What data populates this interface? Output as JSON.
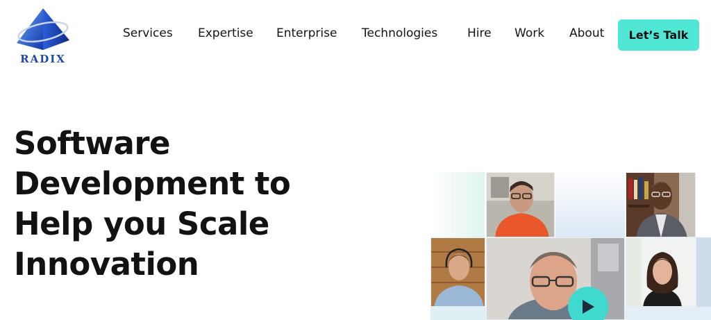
{
  "brand": {
    "name": "RADIX",
    "color": "#1f46b0"
  },
  "nav": {
    "items": [
      "Services",
      "Expertise",
      "Enterprise",
      "Technologies",
      "Hire",
      "Work",
      "About"
    ],
    "cta_label": "Let’s Talk",
    "cta_color": "#4fe6d4"
  },
  "hero": {
    "title_lines": [
      "Software",
      "Development to",
      "Help you Scale",
      "Innovation"
    ]
  },
  "video": {
    "play_icon": "play-icon",
    "accent_color": "#3fd9cf"
  }
}
